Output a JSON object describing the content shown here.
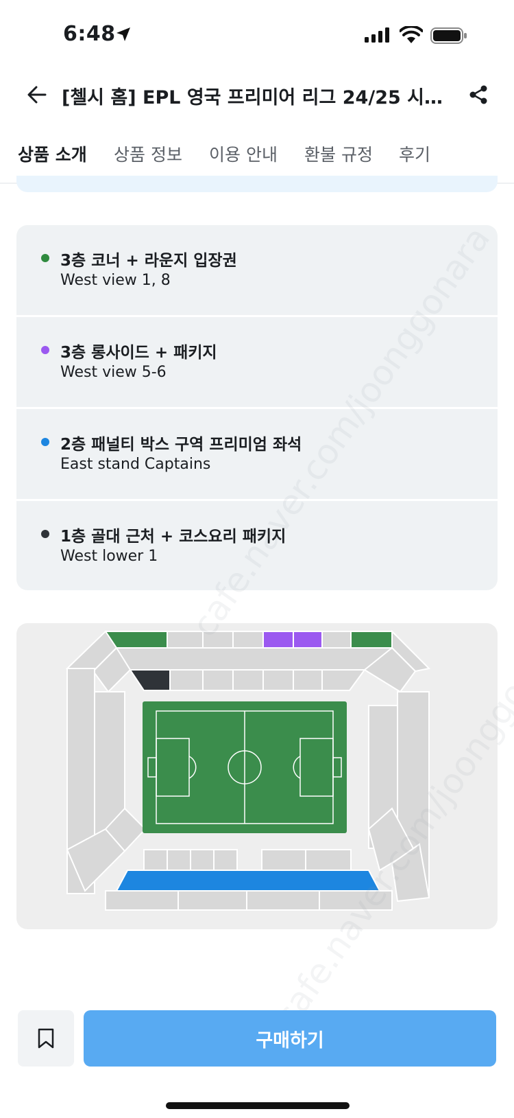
{
  "status_bar": {
    "time": "6:48"
  },
  "header": {
    "title": "[첼시 홈] EPL 영국 프리미어 리그 24/25 시즌 공...",
    "back_icon": "arrow-left-icon",
    "share_icon": "share-icon"
  },
  "tabs": [
    {
      "label": "상품 소개",
      "active": true
    },
    {
      "label": "상품 정보",
      "active": false
    },
    {
      "label": "이용 안내",
      "active": false
    },
    {
      "label": "환불 규정",
      "active": false
    },
    {
      "label": "후기",
      "active": false
    }
  ],
  "seats": [
    {
      "name": "3층 코너 + 라운지 입장권",
      "desc": "West view 1, 8",
      "color": "#2f8a3e"
    },
    {
      "name": "3층 롱사이드 + 패키지",
      "desc": "West view 5-6",
      "color": "#9b59f0"
    },
    {
      "name": "2층 패널티 박스 구역 프리미엄 좌석",
      "desc": "East stand Captains",
      "color": "#1d86e0"
    },
    {
      "name": "1층 골대 근처 + 코스요리 패키지",
      "desc": "West lower 1",
      "color": "#2f3338"
    }
  ],
  "map_colors": {
    "pitch": "#3b8d4c",
    "section": "#d8d8d8",
    "green_section": "#3b8d4c",
    "purple_section": "#9b59f0",
    "dark_section": "#2f3338",
    "blue_section": "#1d86e0"
  },
  "watermark": "cafe.naver.com/joonggonara",
  "bottom": {
    "buy_label": "구매하기",
    "bookmark_icon": "bookmark-icon"
  }
}
